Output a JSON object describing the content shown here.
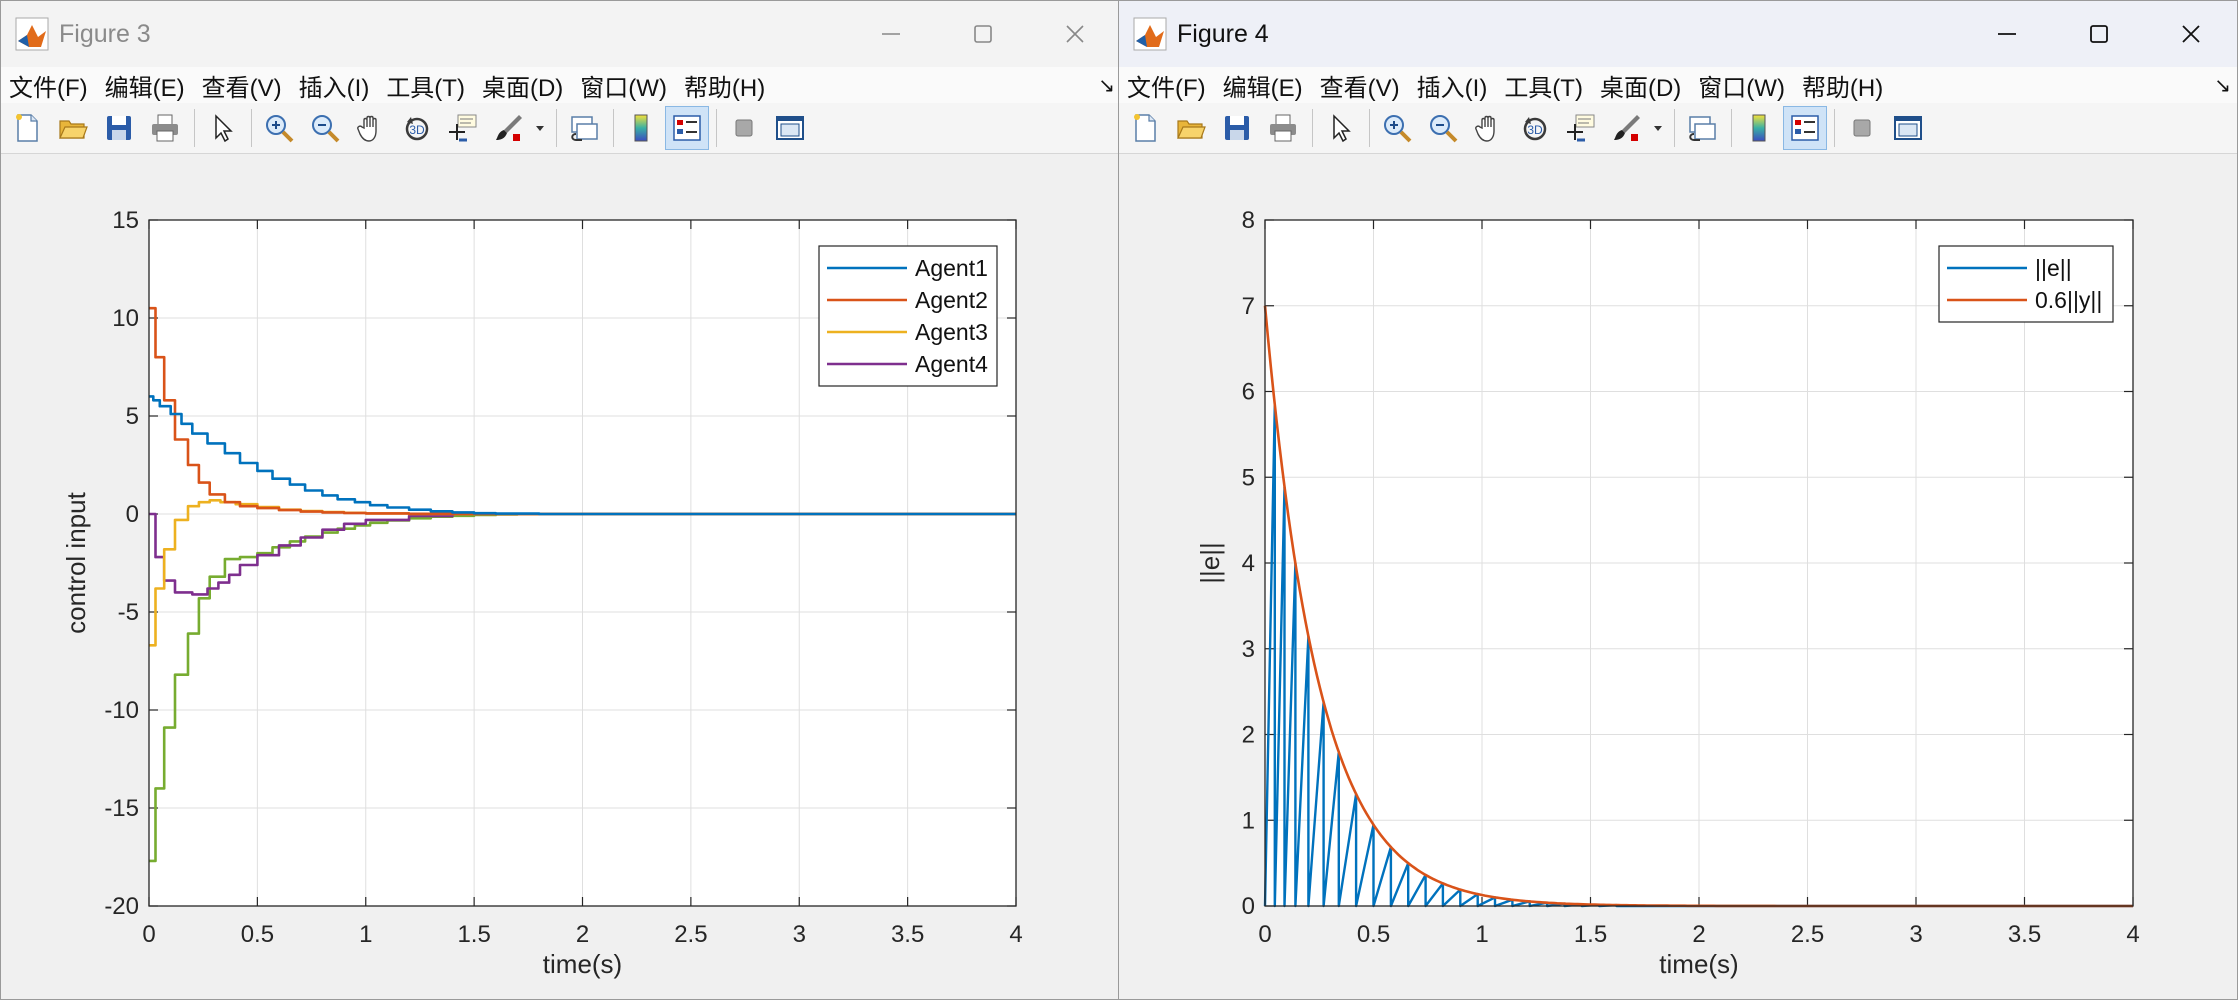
{
  "figures": [
    {
      "id": "fig3",
      "window_title": "Figure 3",
      "focused": false,
      "menu": [
        "文件(F)",
        "编辑(E)",
        "查看(V)",
        "插入(I)",
        "工具(T)",
        "桌面(D)",
        "窗口(W)",
        "帮助(H)"
      ],
      "chart_data": {
        "type": "line",
        "title": "",
        "xlabel": "time(s)",
        "ylabel": "control input",
        "xlim": [
          0,
          4
        ],
        "ylim": [
          -20,
          15
        ],
        "xticks": [
          0,
          0.5,
          1,
          1.5,
          2,
          2.5,
          3,
          3.5,
          4
        ],
        "xtick_labels": [
          "0",
          "0.5",
          "1",
          "1.5",
          "2",
          "2.5",
          "3",
          "3.5",
          "4"
        ],
        "yticks": [
          -20,
          -15,
          -10,
          -5,
          0,
          5,
          10,
          15
        ],
        "ytick_labels": [
          "-20",
          "-15",
          "-10",
          "-5",
          "0",
          "5",
          "10",
          "15"
        ],
        "grid": true,
        "legend_position": "top-right",
        "step": true,
        "series": [
          {
            "name": "Agent1",
            "color": "#0072BD",
            "x": [
              0,
              0.02,
              0.05,
              0.1,
              0.15,
              0.2,
              0.27,
              0.35,
              0.42,
              0.5,
              0.57,
              0.65,
              0.72,
              0.8,
              0.87,
              0.95,
              1.02,
              1.1,
              1.2,
              1.3,
              1.4,
              1.5,
              1.6,
              1.8,
              4
            ],
            "y": [
              6.0,
              5.8,
              5.5,
              5.1,
              4.6,
              4.1,
              3.6,
              3.1,
              2.6,
              2.2,
              1.8,
              1.5,
              1.2,
              0.95,
              0.75,
              0.6,
              0.45,
              0.33,
              0.22,
              0.14,
              0.08,
              0.04,
              0.02,
              0.0,
              0.0
            ]
          },
          {
            "name": "Agent2",
            "color": "#D95319",
            "x": [
              0,
              0.03,
              0.07,
              0.12,
              0.18,
              0.23,
              0.28,
              0.35,
              0.42,
              0.5,
              0.6,
              0.7,
              0.8,
              0.9,
              1.0,
              1.2,
              1.4,
              4
            ],
            "y": [
              10.5,
              8.0,
              5.8,
              3.8,
              2.5,
              1.6,
              1.0,
              0.6,
              0.4,
              0.3,
              0.2,
              0.12,
              0.08,
              0.05,
              0.03,
              0.01,
              0.0,
              0.0
            ]
          },
          {
            "name": "Agent3",
            "color": "#EDB120",
            "x": [
              0,
              0.03,
              0.07,
              0.12,
              0.18,
              0.23,
              0.28,
              0.33,
              0.4,
              0.5,
              0.6,
              0.7,
              0.8,
              0.9,
              1.0,
              1.2,
              4
            ],
            "y": [
              -6.7,
              -3.8,
              -1.8,
              -0.3,
              0.4,
              0.6,
              0.7,
              0.6,
              0.5,
              0.35,
              0.22,
              0.15,
              0.1,
              0.06,
              0.03,
              0.0,
              0.0
            ]
          },
          {
            "name": "Agent4",
            "color": "#7E2F8E",
            "x": [
              0,
              0.03,
              0.07,
              0.12,
              0.2,
              0.27,
              0.32,
              0.37,
              0.42,
              0.5,
              0.6,
              0.7,
              0.8,
              0.9,
              1.0,
              1.2,
              1.4,
              4
            ],
            "y": [
              0.0,
              -2.2,
              -3.4,
              -4.0,
              -4.1,
              -3.8,
              -3.5,
              -3.1,
              -2.6,
              -2.1,
              -1.6,
              -1.2,
              -0.8,
              -0.5,
              -0.3,
              -0.1,
              0.0,
              0.0
            ]
          },
          {
            "name": "",
            "color": "#77AC30",
            "x": [
              0,
              0.03,
              0.07,
              0.12,
              0.18,
              0.23,
              0.28,
              0.35,
              0.42,
              0.5,
              0.57,
              0.65,
              0.72,
              0.8,
              0.87,
              0.95,
              1.02,
              1.1,
              1.2,
              1.3,
              1.4,
              1.5,
              1.6,
              1.7,
              1.8,
              4
            ],
            "y": [
              -17.7,
              -14.0,
              -10.9,
              -8.2,
              -6.1,
              -4.3,
              -3.2,
              -2.3,
              -2.2,
              -2.0,
              -1.7,
              -1.4,
              -1.15,
              -0.95,
              -0.75,
              -0.58,
              -0.45,
              -0.33,
              -0.22,
              -0.14,
              -0.09,
              -0.05,
              -0.02,
              -0.01,
              0.0,
              0.0
            ]
          }
        ]
      }
    },
    {
      "id": "fig4",
      "window_title": "Figure 4",
      "focused": true,
      "menu": [
        "文件(F)",
        "编辑(E)",
        "查看(V)",
        "插入(I)",
        "工具(T)",
        "桌面(D)",
        "窗口(W)",
        "帮助(H)"
      ],
      "chart_data": {
        "type": "line",
        "title": "",
        "xlabel": "time(s)",
        "ylabel": "||e||",
        "xlim": [
          0,
          4
        ],
        "ylim": [
          0,
          8
        ],
        "xticks": [
          0,
          0.5,
          1,
          1.5,
          2,
          2.5,
          3,
          3.5,
          4
        ],
        "xtick_labels": [
          "0",
          "0.5",
          "1",
          "1.5",
          "2",
          "2.5",
          "3",
          "3.5",
          "4"
        ],
        "yticks": [
          0,
          1,
          2,
          3,
          4,
          5,
          6,
          7,
          8
        ],
        "ytick_labels": [
          "0",
          "1",
          "2",
          "3",
          "4",
          "5",
          "6",
          "7",
          "8"
        ],
        "grid": true,
        "legend_position": "top-right",
        "series": [
          {
            "name": "||e||",
            "color": "#0072BD",
            "type": "sawtooth",
            "event_times": [
              0,
              0.045,
              0.09,
              0.14,
              0.2,
              0.27,
              0.34,
              0.42,
              0.5,
              0.58,
              0.66,
              0.74,
              0.82,
              0.9,
              0.98,
              1.06,
              1.14,
              1.22,
              1.3,
              1.38,
              1.46,
              1.54,
              1.62
            ],
            "envelope": {
              "y0": 7.0,
              "decay_rate": 4.0
            }
          },
          {
            "name": "0.6||y||",
            "color": "#D95319",
            "type": "exponential",
            "envelope": {
              "y0": 7.0,
              "decay_rate": 4.0
            }
          }
        ]
      }
    }
  ]
}
